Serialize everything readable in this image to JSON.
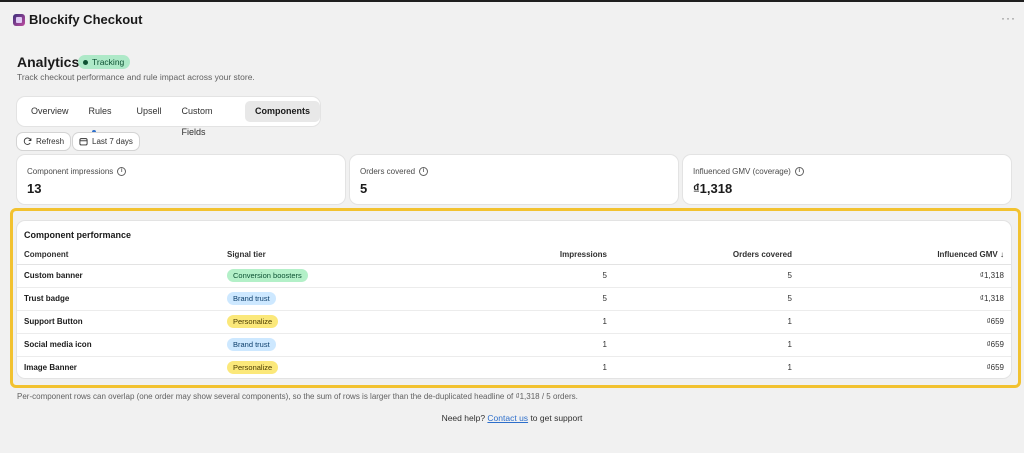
{
  "app": {
    "title": "Blockify Checkout",
    "more_icon": "ellipsis-icon"
  },
  "header": {
    "title": "Analytics",
    "status": "Tracking",
    "subtitle": "Track checkout performance and rule impact across your store."
  },
  "tabs": [
    {
      "label": "Overview",
      "active": false
    },
    {
      "label": "Rules",
      "active": false,
      "dot": true
    },
    {
      "label": "Upsell",
      "active": false
    },
    {
      "label": "Custom Fields",
      "active": false
    },
    {
      "label": "Components",
      "active": true
    }
  ],
  "toolbar": {
    "refresh_label": "Refresh",
    "range_label": "Last 7 days"
  },
  "stats": [
    {
      "label": "Component impressions",
      "value": "13"
    },
    {
      "label": "Orders covered",
      "value": "5"
    },
    {
      "label": "Influenced GMV (coverage)",
      "value": "₫1,318"
    }
  ],
  "performance": {
    "title": "Component performance",
    "columns": [
      "Component",
      "Signal tier",
      "Impressions",
      "Orders covered",
      "Influenced GMV"
    ],
    "sort_icon": "↓",
    "rows": [
      {
        "component": "Custom banner",
        "tier": "Conversion boosters",
        "tier_color": "green",
        "impressions": "5",
        "orders": "5",
        "gmv": "₫1,318"
      },
      {
        "component": "Trust badge",
        "tier": "Brand trust",
        "tier_color": "blue",
        "impressions": "5",
        "orders": "5",
        "gmv": "₫1,318"
      },
      {
        "component": "Support Button",
        "tier": "Personalize",
        "tier_color": "yellow",
        "impressions": "1",
        "orders": "1",
        "gmv": "₫659"
      },
      {
        "component": "Social media icon",
        "tier": "Brand trust",
        "tier_color": "blue",
        "impressions": "1",
        "orders": "1",
        "gmv": "₫659"
      },
      {
        "component": "Image Banner",
        "tier": "Personalize",
        "tier_color": "yellow",
        "impressions": "1",
        "orders": "1",
        "gmv": "₫659"
      }
    ]
  },
  "footnote": "Per-component rows can overlap (one order may show several components), so the sum of rows is larger than the de-duplicated headline of ₫1,318 / 5 orders.",
  "help": {
    "prefix": "Need help?",
    "link": "Contact us",
    "suffix": "to get support"
  }
}
